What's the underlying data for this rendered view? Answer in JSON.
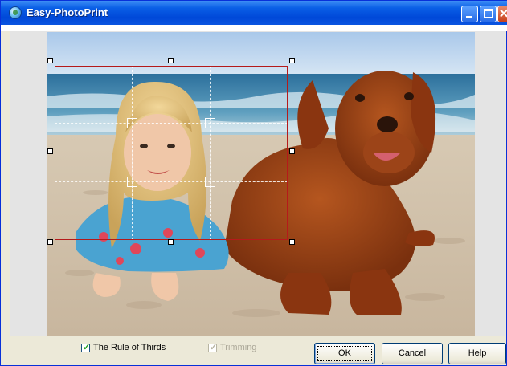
{
  "window": {
    "title": "Easy-PhotoPrint"
  },
  "titlebar_buttons": {
    "minimize": "minimize",
    "maximize": "maximize",
    "close": "✕"
  },
  "image": {
    "description": "photo of a girl and a golden retriever on a beach"
  },
  "options": {
    "rule_of_thirds": {
      "label": "The Rule of Thirds",
      "checked": true,
      "enabled": true
    },
    "trimming": {
      "label": "Trimming",
      "checked": true,
      "enabled": false
    }
  },
  "buttons": {
    "ok": "OK",
    "cancel": "Cancel",
    "help": "Help"
  },
  "colors": {
    "title_bar": "#0a54e0",
    "crop_border": "#b51a1a",
    "dialog_bg": "#ece9d8"
  }
}
